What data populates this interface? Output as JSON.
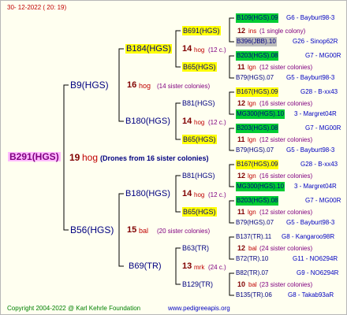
{
  "header": {
    "date": "30-  12-2022  ( 20: 19)"
  },
  "footer": {
    "copyright": "Copyright 2004-2022 @ Karl Kehrle Foundation",
    "website": "www.pedigreeapis.org"
  },
  "root": {
    "id": "B291(HGS)",
    "gen": "19",
    "breed": "hog",
    "note": "(Drones from 16 sister colonies)"
  },
  "sire": {
    "id": "B9(HGS)",
    "gen": "16",
    "breed": "hog",
    "note": "(14 sister colonies)"
  },
  "dam": {
    "id": "B56(HGS)",
    "gen": "15",
    "breed": "bal",
    "note": "(20 sister colonies)"
  },
  "ss": {
    "id": "B184(HGS)",
    "gen": "14",
    "breed": "hog",
    "note": "(12 c.)"
  },
  "sd": {
    "id": "B180(HGS)",
    "gen": "14",
    "breed": "hog",
    "note": "(12 c.)"
  },
  "ds": {
    "id": "B180(HGS)",
    "gen": "14",
    "breed": "hog",
    "note": "(12 c.)"
  },
  "dd": {
    "id": "B69(TR)",
    "gen": "13",
    "breed": "mrk",
    "note": "(24 c.)"
  },
  "g3": [
    {
      "id": "B691(HGS)",
      "gen": "12",
      "breed": "ins",
      "note": "(1 single colony)",
      "top": {
        "id": "B109(HGS).09",
        "info": "G6 - Bayburt98-3"
      },
      "bot": {
        "id": "B396(JBB).10",
        "info": "G26 - Sinop62R"
      }
    },
    {
      "id": "B65(HGS)",
      "gen": "11",
      "breed": "lgn",
      "note": "(12 sister colonies)",
      "top": {
        "id": "B203(HGS).08",
        "info": "G7 - MG00R"
      },
      "bot": {
        "id": "B79(HGS).07",
        "info": "G5 - Bayburt98-3"
      }
    },
    {
      "id": "B81(HGS)",
      "gen": "12",
      "breed": "lgn",
      "note": "(16 sister colonies)",
      "top": {
        "id": "B167(HGS).09",
        "info": "G28 - B-xx43"
      },
      "bot": {
        "id": "MG300(HGS).10",
        "info": "3 - Margret04R"
      }
    },
    {
      "id": "B65(HGS)",
      "gen": "11",
      "breed": "lgn",
      "note": "(12 sister colonies)",
      "top": {
        "id": "B203(HGS).08",
        "info": "G7 - MG00R"
      },
      "bot": {
        "id": "B79(HGS).07",
        "info": "G5 - Bayburt98-3"
      }
    },
    {
      "id": "B81(HGS)",
      "gen": "12",
      "breed": "lgn",
      "note": "(16 sister colonies)",
      "top": {
        "id": "B167(HGS).09",
        "info": "G28 - B-xx43"
      },
      "bot": {
        "id": "MG300(HGS).10",
        "info": "3 - Margret04R"
      }
    },
    {
      "id": "B65(HGS)",
      "gen": "11",
      "breed": "lgn",
      "note": "(12 sister colonies)",
      "top": {
        "id": "B203(HGS).08",
        "info": "G7 - MG00R"
      },
      "bot": {
        "id": "B79(HGS).07",
        "info": "G5 - Bayburt98-3"
      }
    },
    {
      "id": "B63(TR)",
      "gen": "12",
      "breed": "bal",
      "note": "(24 sister colonies)",
      "top": {
        "id": "B137(TR).11",
        "info": "G8 - Kangaroo98R"
      },
      "bot": {
        "id": "B72(TR).10",
        "info": "G11 - NO6294R"
      }
    },
    {
      "id": "B129(TR)",
      "gen": "10",
      "breed": "bal",
      "note": "(23 sister colonies)",
      "top": {
        "id": "B82(TR).07",
        "info": "G9 - NO6294R"
      },
      "bot": {
        "id": "B135(TR).06",
        "info": "G8 - Takab93aR"
      }
    }
  ]
}
